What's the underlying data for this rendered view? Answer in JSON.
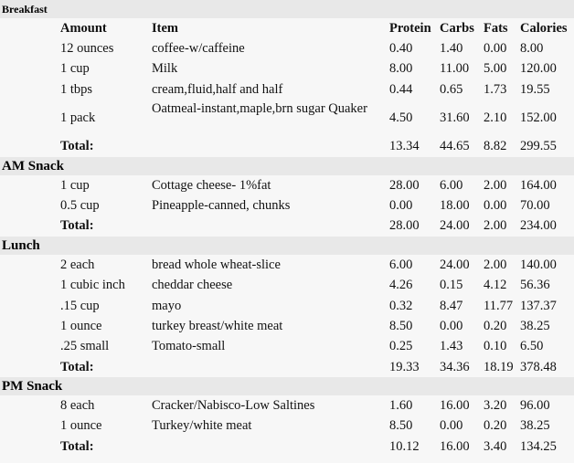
{
  "columns": {
    "amount": "Amount",
    "item": "Item",
    "protein": "Protein",
    "carbs": "Carbs",
    "fats": "Fats",
    "calories": "Calories"
  },
  "total_label": "Total:",
  "meals": [
    {
      "name": "Breakfast",
      "items": [
        {
          "amount": "12 ounces",
          "item": "coffee-w/caffeine",
          "protein": "0.40",
          "carbs": "1.40",
          "fats": "0.00",
          "calories": "8.00"
        },
        {
          "amount": "1 cup",
          "item": "Milk",
          "protein": "8.00",
          "carbs": "11.00",
          "fats": "5.00",
          "calories": "120.00"
        },
        {
          "amount": "1 tbps",
          "item": "cream,fluid,half and half",
          "protein": "0.44",
          "carbs": "0.65",
          "fats": "1.73",
          "calories": "19.55"
        },
        {
          "amount": "1 pack",
          "item": "Oatmeal-instant,maple,brn sugar Quaker",
          "protein": "4.50",
          "carbs": "31.60",
          "fats": "2.10",
          "calories": "152.00"
        }
      ],
      "total": {
        "protein": "13.34",
        "carbs": "44.65",
        "fats": "8.82",
        "calories": "299.55"
      }
    },
    {
      "name": "AM Snack",
      "items": [
        {
          "amount": "1 cup",
          "item": "Cottage cheese- 1%fat",
          "protein": "28.00",
          "carbs": "6.00",
          "fats": "2.00",
          "calories": "164.00"
        },
        {
          "amount": "0.5 cup",
          "item": "Pineapple-canned, chunks",
          "protein": "0.00",
          "carbs": "18.00",
          "fats": "0.00",
          "calories": "70.00"
        }
      ],
      "total": {
        "protein": "28.00",
        "carbs": "24.00",
        "fats": "2.00",
        "calories": "234.00"
      }
    },
    {
      "name": "Lunch",
      "items": [
        {
          "amount": "2 each",
          "item": "bread whole wheat-slice",
          "protein": "6.00",
          "carbs": "24.00",
          "fats": "2.00",
          "calories": "140.00"
        },
        {
          "amount": "1 cubic inch",
          "item": "cheddar cheese",
          "protein": "4.26",
          "carbs": "0.15",
          "fats": "4.12",
          "calories": "56.36"
        },
        {
          "amount": ".15 cup",
          "item": "mayo",
          "protein": "0.32",
          "carbs": "8.47",
          "fats": "11.77",
          "calories": "137.37"
        },
        {
          "amount": "1 ounce",
          "item": "turkey breast/white meat",
          "protein": "8.50",
          "carbs": "0.00",
          "fats": "0.20",
          "calories": "38.25"
        },
        {
          "amount": ".25 small",
          "item": "Tomato-small",
          "protein": "0.25",
          "carbs": "1.43",
          "fats": "0.10",
          "calories": "6.50"
        }
      ],
      "total": {
        "protein": "19.33",
        "carbs": "34.36",
        "fats": "18.19",
        "calories": "378.48"
      }
    },
    {
      "name": "PM Snack",
      "items": [
        {
          "amount": "8 each",
          "item": "Cracker/Nabisco-Low Saltines",
          "protein": "1.60",
          "carbs": "16.00",
          "fats": "3.20",
          "calories": "96.00"
        },
        {
          "amount": "1 ounce",
          "item": "Turkey/white meat",
          "protein": "8.50",
          "carbs": "0.00",
          "fats": "0.20",
          "calories": "38.25"
        }
      ],
      "total": {
        "protein": "10.12",
        "carbs": "16.00",
        "fats": "3.40",
        "calories": "134.25"
      }
    }
  ]
}
